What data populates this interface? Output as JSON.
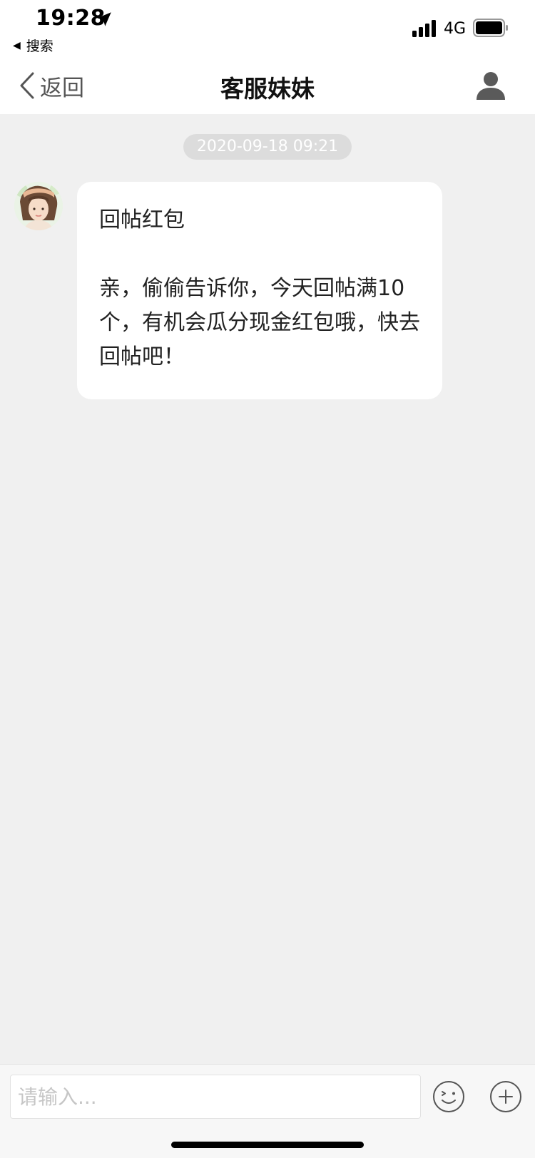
{
  "status_bar": {
    "time": "19:28",
    "back_app_label": "搜索",
    "network": "4G"
  },
  "nav": {
    "back_label": "返回",
    "title": "客服妹妹"
  },
  "chat": {
    "timestamp": "2020-09-18 09:21",
    "messages": [
      {
        "title": "回帖红包",
        "body": "亲，偷偷告诉你，今天回帖满10个，有机会瓜分现金红包哦，快去回帖吧！"
      }
    ]
  },
  "input_bar": {
    "placeholder": "请输入..."
  },
  "icons": {
    "location": "location-arrow-icon",
    "signal": "signal-icon",
    "battery": "battery-icon",
    "back": "chevron-left-icon",
    "profile": "user-icon",
    "emoji": "smiley-icon",
    "plus": "plus-circle-icon"
  }
}
